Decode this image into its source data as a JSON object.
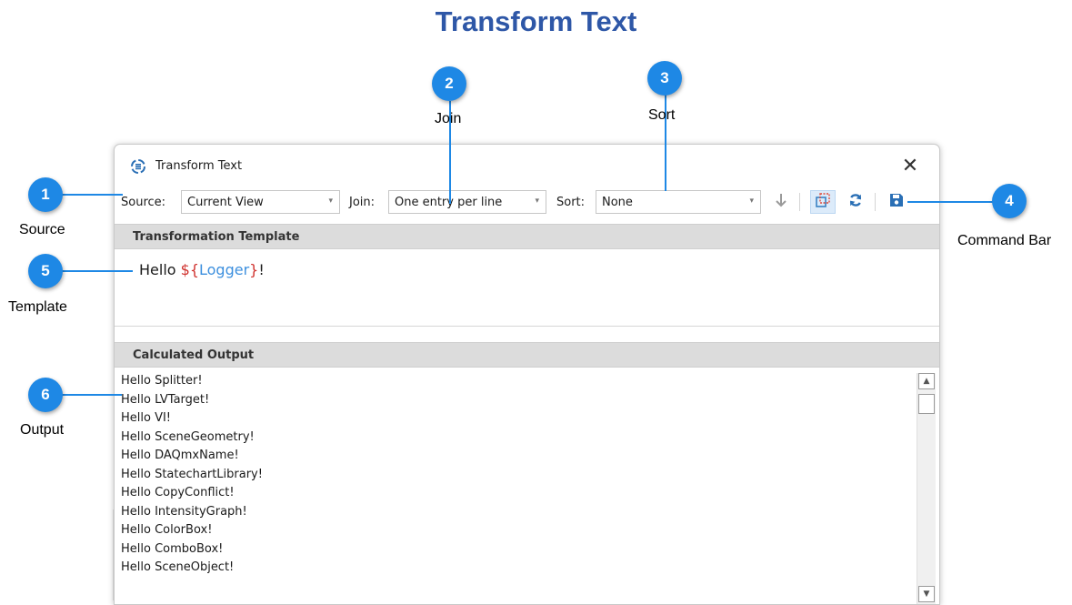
{
  "page": {
    "title": "Transform Text"
  },
  "callouts": [
    {
      "number": "1",
      "label": "Source"
    },
    {
      "number": "2",
      "label": "Join"
    },
    {
      "number": "3",
      "label": "Sort"
    },
    {
      "number": "4",
      "label": "Command Bar"
    },
    {
      "number": "5",
      "label": "Template"
    },
    {
      "number": "6",
      "label": "Output"
    }
  ],
  "dialog": {
    "title": "Transform Text",
    "app_icon": "transform-icon",
    "close_glyph": "✕",
    "toolbar": {
      "source_label": "Source:",
      "source_value": "Current View",
      "join_label": "Join:",
      "join_value": "One entry per line",
      "sort_label": "Sort:",
      "sort_value": "None",
      "dropdown_glyph": "▾",
      "buttons": [
        "sort-direction-icon",
        "select-region-icon",
        "refresh-icon",
        "save-icon"
      ]
    },
    "template_section": {
      "header": "Transformation Template",
      "prefix": "Hello ",
      "brace_open": "${",
      "variable": "Logger",
      "brace_close": "}",
      "suffix": "!"
    },
    "output_section": {
      "header": "Calculated Output",
      "lines": [
        "Hello Splitter!",
        "Hello LVTarget!",
        "Hello VI!",
        "Hello SceneGeometry!",
        "Hello DAQmxName!",
        "Hello StatechartLibrary!",
        "Hello CopyConflict!",
        "Hello IntensityGraph!",
        "Hello ColorBox!",
        "Hello ComboBox!",
        "Hello SceneObject!"
      ]
    },
    "scrollbar": {
      "up_glyph": "▲",
      "down_glyph": "▼"
    }
  },
  "colors": {
    "title": "#2e57a7",
    "callout": "#1e88e5",
    "template_brace": "#d0312d",
    "template_variable": "#3c8fde",
    "save_icon": "#2a6fb5",
    "refresh_icon": "#2a6fb5",
    "select_icon": "#3b82c4",
    "select_icon_accent": "#e04a3a"
  }
}
